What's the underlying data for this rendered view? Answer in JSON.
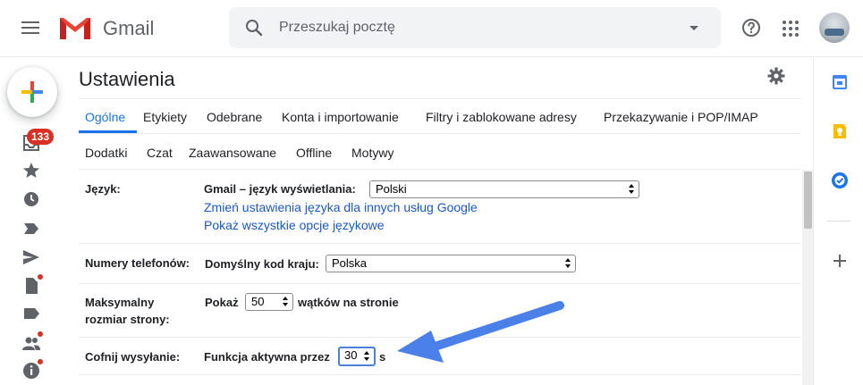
{
  "app": {
    "name": "Gmail"
  },
  "search": {
    "placeholder": "Przeszukaj pocztę"
  },
  "rail": {
    "inbox_badge": "133"
  },
  "settings": {
    "title": "Ustawienia",
    "tabs_row1": [
      "Ogólne",
      "Etykiety",
      "Odebrane",
      "Konta i importowanie",
      "Filtry i zablokowane adresy",
      "Przekazywanie i POP/IMAP"
    ],
    "tabs_row2": [
      "Dodatki",
      "Czat",
      "Zaawansowane",
      "Offline",
      "Motywy"
    ],
    "active_tab": "Ogólne",
    "language": {
      "label": "Język:",
      "display_label": "Gmail – język wyświetlania:",
      "display_value": "Polski",
      "link_change": "Zmień ustawienia języka dla innych usług Google",
      "link_all": "Pokaż wszystkie opcje językowe"
    },
    "phone": {
      "label": "Numery telefonów:",
      "country_label": "Domyślny kod kraju:",
      "country_value": "Polska"
    },
    "page_size": {
      "label": "Maksymalny rozmiar strony:",
      "show_label": "Pokaż",
      "value": "50",
      "suffix": "wątków na stronie"
    },
    "undo_send": {
      "label": "Cofnij wysyłanie:",
      "active_label": "Funkcja aktywna przez",
      "value": "30",
      "suffix": "s"
    }
  },
  "colors": {
    "accent": "#1a73e8",
    "link": "#1a57c4",
    "badge": "#d93025",
    "annotation_arrow": "#4a80e8"
  }
}
